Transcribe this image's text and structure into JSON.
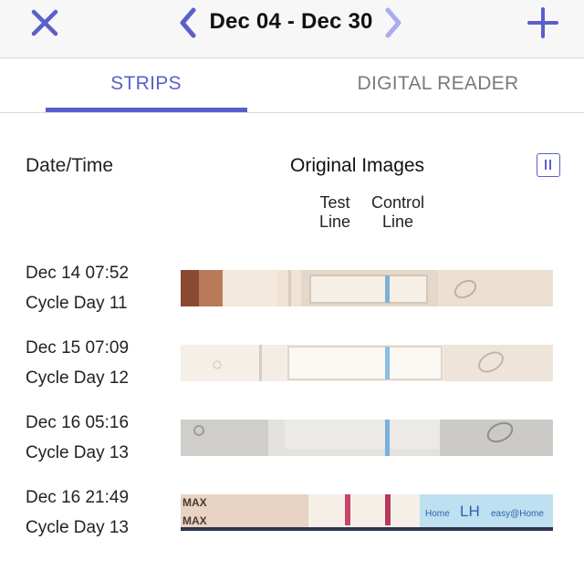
{
  "header": {
    "date_range": "Dec 04 - Dec 30",
    "accent_color": "#5a5fcc",
    "icons": {
      "close": "close-icon",
      "prev": "chevron-left-icon",
      "next": "chevron-right-icon",
      "add": "plus-icon"
    }
  },
  "tabs": [
    {
      "label": "STRIPS",
      "active": true
    },
    {
      "label": "DIGITAL READER",
      "active": false
    }
  ],
  "table": {
    "date_header": "Date/Time",
    "images_header": "Original Images",
    "test_line_label": "Test\nLine",
    "control_line_label": "Control\nLine",
    "pause_icon": "pause-icon"
  },
  "rows": [
    {
      "datetime": "Dec 14 07:52",
      "cycle_day": "Cycle Day 11"
    },
    {
      "datetime": "Dec 15 07:09",
      "cycle_day": "Cycle Day 12"
    },
    {
      "datetime": "Dec 16 05:16",
      "cycle_day": "Cycle Day 13"
    },
    {
      "datetime": "Dec 16 21:49",
      "cycle_day": "Cycle Day 13"
    }
  ],
  "strip4_text": {
    "max": "MAX",
    "brand": "Home",
    "lh": "LH",
    "brand2": "easy@Home"
  }
}
